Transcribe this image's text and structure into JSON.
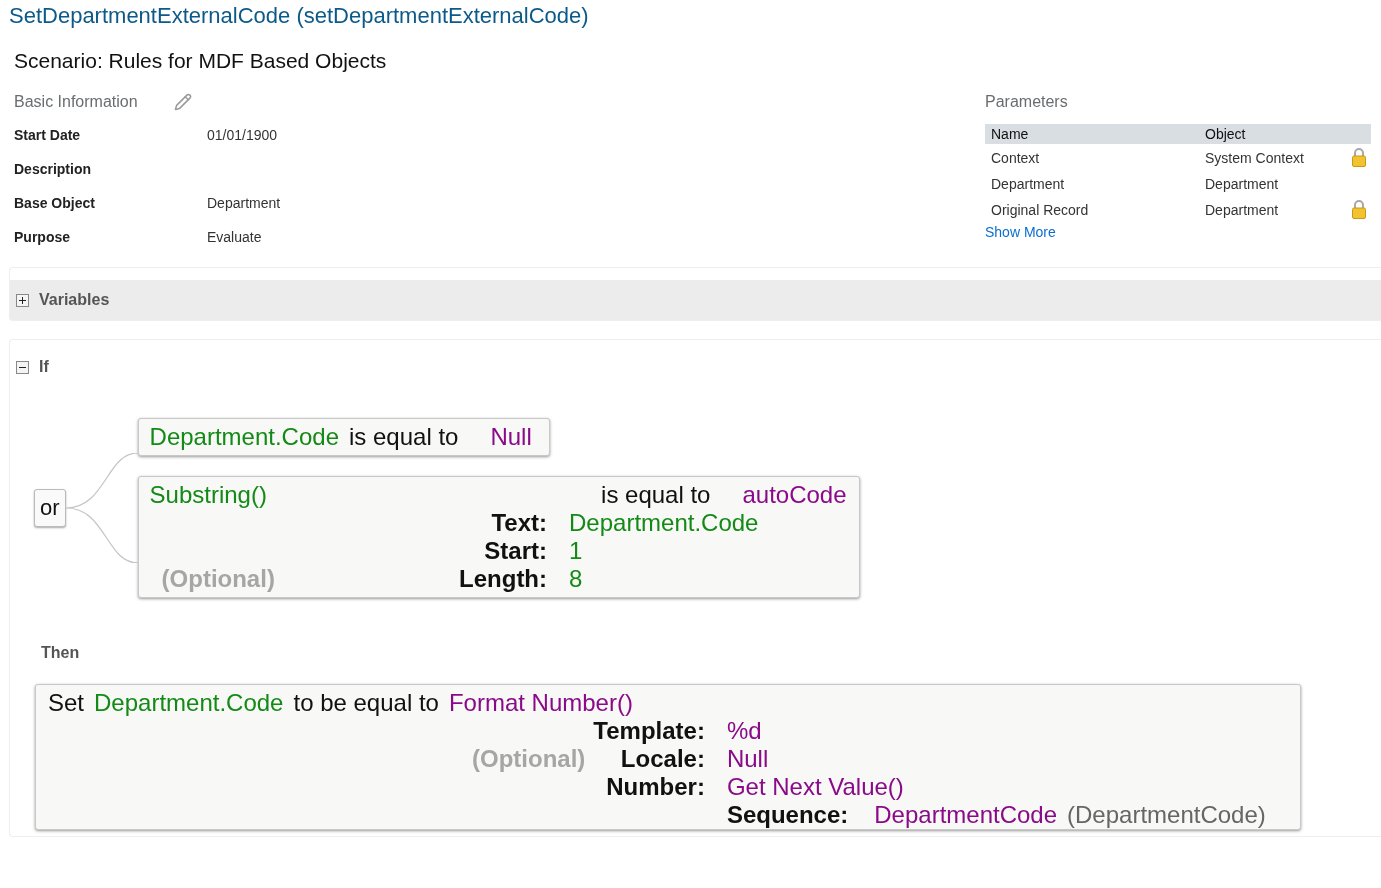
{
  "title": "SetDepartmentExternalCode (setDepartmentExternalCode)",
  "scenario": "Scenario: Rules for MDF Based Objects",
  "basic_info": {
    "heading": "Basic Information",
    "fields": [
      {
        "label": "Start Date",
        "value": "01/01/1900"
      },
      {
        "label": "Description"
      },
      {
        "label": "Base Object",
        "value": "Department"
      },
      {
        "label": "Purpose",
        "value": "Evaluate"
      }
    ]
  },
  "parameters": {
    "heading": "Parameters",
    "columns": [
      "Name",
      "Object"
    ],
    "rows": [
      {
        "name": "Context",
        "object": "System Context",
        "locked": true
      },
      {
        "name": "Department",
        "object": "Department",
        "locked": false
      },
      {
        "name": "Original Record",
        "object": "Department",
        "locked": true
      }
    ],
    "show_more": "Show More"
  },
  "variables": {
    "label": "Variables",
    "expanded": false
  },
  "if_section": {
    "label": "If",
    "expanded": true,
    "operator": "or",
    "conditions": [
      {
        "left": {
          "text": "Department.Code",
          "kind": "field"
        },
        "comparator": "is equal to",
        "right": {
          "text": "Null",
          "kind": "value"
        }
      },
      {
        "left": {
          "text": "Substring()",
          "kind": "field"
        },
        "comparator": "is equal to",
        "right": {
          "text": "autoCode",
          "kind": "value"
        },
        "args": [
          {
            "label": "Text:",
            "value": {
              "text": "Department.Code",
              "kind": "field"
            }
          },
          {
            "label": "Start:",
            "value": {
              "text": "1",
              "kind": "field"
            }
          },
          {
            "optional": "(Optional)",
            "label": "Length:",
            "value": {
              "text": "8",
              "kind": "field"
            }
          }
        ]
      }
    ]
  },
  "then_section": {
    "label": "Then",
    "action": {
      "prefix": "Set",
      "target": {
        "text": "Department.Code",
        "kind": "field"
      },
      "verb": "to be equal to",
      "value": {
        "text": "Format Number()",
        "kind": "value"
      },
      "args": [
        {
          "label": "Template:",
          "value": {
            "text": "%d",
            "kind": "value"
          }
        },
        {
          "optional": "(Optional)",
          "label": "Locale:",
          "value": {
            "text": "Null",
            "kind": "value"
          }
        },
        {
          "label": "Number:",
          "value": {
            "text": "Get Next Value()",
            "kind": "value"
          },
          "args": [
            {
              "label": "Sequence:",
              "value": {
                "text": "DepartmentCode",
                "kind": "value"
              },
              "note": "(DepartmentCode)"
            }
          ]
        }
      ]
    }
  }
}
